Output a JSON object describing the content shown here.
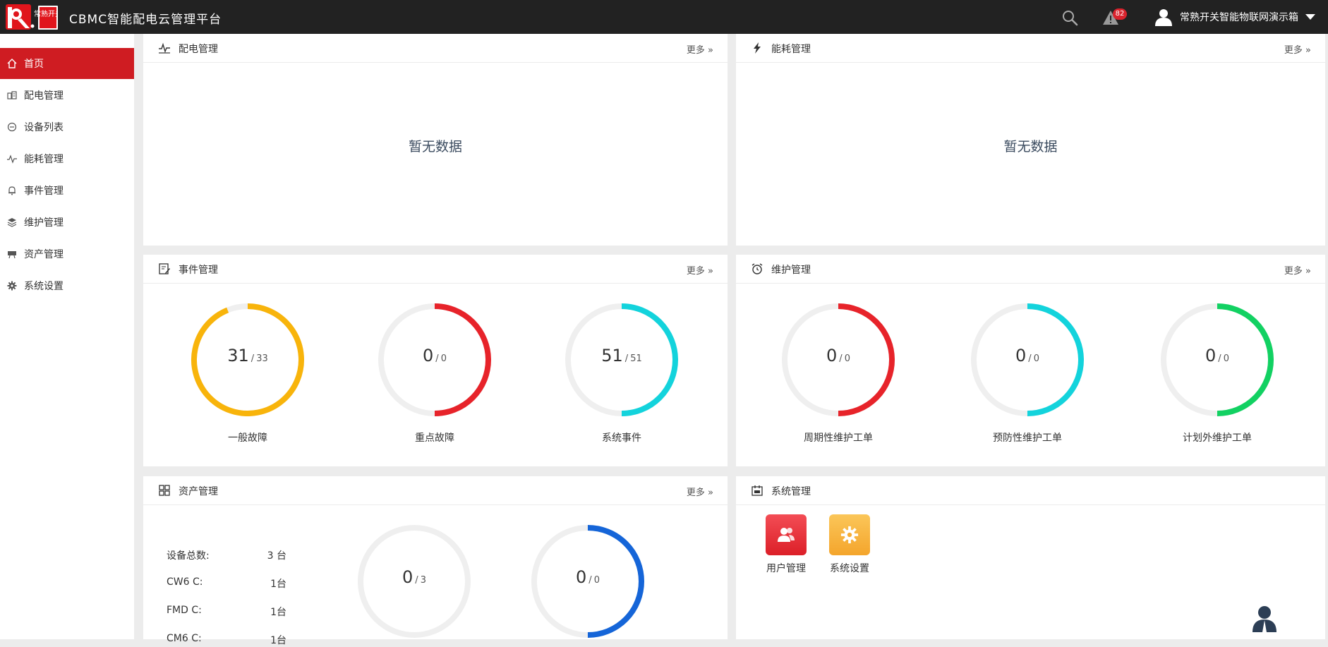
{
  "app": {
    "title": "CBMC智能配电云管理平台",
    "logo_text": "常熟开关"
  },
  "header": {
    "alert_count": "82",
    "user_name": "常熟开关智能物联网演示箱"
  },
  "sidebar": {
    "items": [
      {
        "label": "首页",
        "icon": "home-icon",
        "active": true
      },
      {
        "label": "配电管理",
        "icon": "distribution-icon"
      },
      {
        "label": "设备列表",
        "icon": "device-list-icon"
      },
      {
        "label": "能耗管理",
        "icon": "pulse-icon"
      },
      {
        "label": "事件管理",
        "icon": "bell-icon"
      },
      {
        "label": "维护管理",
        "icon": "layers-icon"
      },
      {
        "label": "资产管理",
        "icon": "asset-icon"
      },
      {
        "label": "系统设置",
        "icon": "gear-icon"
      }
    ]
  },
  "panels": {
    "more_label": "更多",
    "distribution": {
      "title": "配电管理",
      "empty_text": "暂无数据"
    },
    "energy": {
      "title": "能耗管理",
      "empty_text": "暂无数据"
    },
    "events": {
      "title": "事件管理",
      "gauges": [
        {
          "value": "31",
          "total": "33",
          "label": "一般故障",
          "color": "#f8b40b",
          "fraction": 0.939
        },
        {
          "value": "0",
          "total": "0",
          "label": "重点故障",
          "color": "#e7232a",
          "fraction": 0.5
        },
        {
          "value": "51",
          "total": "51",
          "label": "系统事件",
          "color": "#13d3dc",
          "fraction": 0.5
        }
      ]
    },
    "maintenance": {
      "title": "维护管理",
      "gauges": [
        {
          "value": "0",
          "total": "0",
          "label": "周期性维护工单",
          "color": "#e7232a",
          "fraction": 0.5
        },
        {
          "value": "0",
          "total": "0",
          "label": "预防性维护工单",
          "color": "#13d3dc",
          "fraction": 0.5
        },
        {
          "value": "0",
          "total": "0",
          "label": "计划外维护工单",
          "color": "#12d162",
          "fraction": 0.5
        }
      ]
    },
    "assets": {
      "title": "资产管理",
      "rows": [
        {
          "k": "设备总数:",
          "v": "3 台"
        },
        {
          "k": "CW6 C:",
          "v": "1台"
        },
        {
          "k": "FMD C:",
          "v": "1台"
        },
        {
          "k": "CM6 C:",
          "v": "1台"
        }
      ],
      "gauges": [
        {
          "value": "0",
          "total": "3",
          "color": "#1565d8",
          "fraction": 0
        },
        {
          "value": "0",
          "total": "0",
          "color": "#1565d8",
          "fraction": 0.5
        }
      ]
    },
    "system": {
      "title": "系统管理",
      "tiles": [
        {
          "label": "用户管理",
          "icon": "users-icon",
          "color": "#e8313a"
        },
        {
          "label": "系统设置",
          "icon": "gear-icon",
          "color": "#f7b23b"
        }
      ]
    }
  }
}
